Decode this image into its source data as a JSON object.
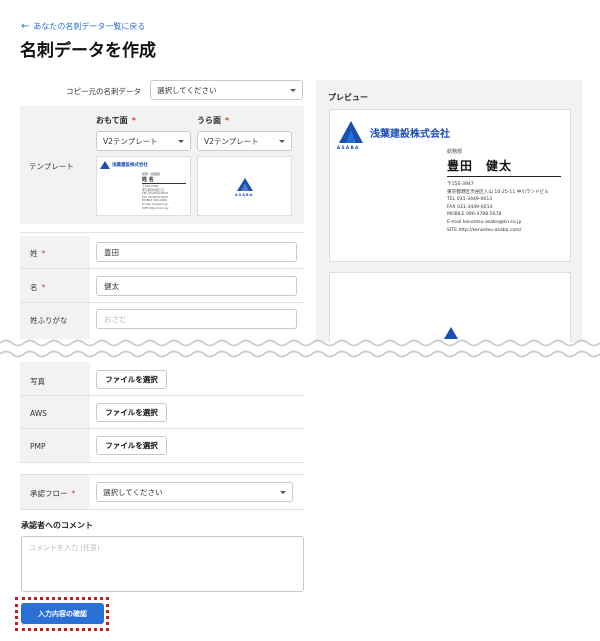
{
  "nav": {
    "back_label": "あなたの名刺データ一覧に戻る"
  },
  "page": {
    "title": "名刺データを作成"
  },
  "form": {
    "copy_source": {
      "label": "コピー元の名刺データ",
      "value": "選択してください"
    },
    "template": {
      "label": "テンプレート",
      "front": {
        "label": "おもて面",
        "value": "V2テンプレート"
      },
      "back": {
        "label": "うら面",
        "value": "V2テンプレート"
      },
      "required_mark": "*"
    },
    "last_name": {
      "label": "姓",
      "value": "豊田"
    },
    "first_name": {
      "label": "名",
      "value": "健太"
    },
    "last_name_kana": {
      "label": "姓ふりがな",
      "placeholder": "おさだ"
    },
    "photo": {
      "label": "写真",
      "button": "ファイルを選択"
    },
    "aws": {
      "label": "AWS",
      "button": "ファイルを選択"
    },
    "pmp": {
      "label": "PMP",
      "button": "ファイルを選択"
    },
    "approval_flow": {
      "label": "承認フロー",
      "value": "選択してください"
    },
    "comment": {
      "label": "承認者へのコメント",
      "placeholder": "コメントを入力 (任意)"
    },
    "submit_label": "入力内容の確認"
  },
  "preview": {
    "label": "プレビュー",
    "card": {
      "company": "浅葉建設株式会社",
      "logo_text": "ASABA",
      "department": "総務部",
      "name": "豊田　健太",
      "postal": "〒150-3947",
      "address": "東京都港区渋谷区入山 10-25-11 中川ランドビル",
      "tel": "TEL 031-3449-0613",
      "fax": "FAX 031-3449-6014",
      "mobile": "MOBILE 096-4788-5678",
      "email": "E-mail kensetsu-asaba@kn.co.jp",
      "site": "SITE http://kensetsu-asaba.com/"
    }
  },
  "mini_front": {
    "company": "浅葉建設株式会社",
    "department": "総務・経理部",
    "name": "姓 名",
    "lines": [
      "〒000-0000",
      "東京都渋谷区〇〇",
      "TEL 00-0000-0000",
      "FAX 00-0000-0000",
      "MOBILE 000-0000",
      "E-mail xxxx@xx.jp",
      "SITE http://xxxx.jp/"
    ]
  },
  "mini_back": {
    "logo_text": "ASABA"
  },
  "colors": {
    "accent": "#2a6fd6",
    "brand": "#1a4fb0",
    "required": "#e03b3b",
    "focus": "#c51c1c"
  }
}
